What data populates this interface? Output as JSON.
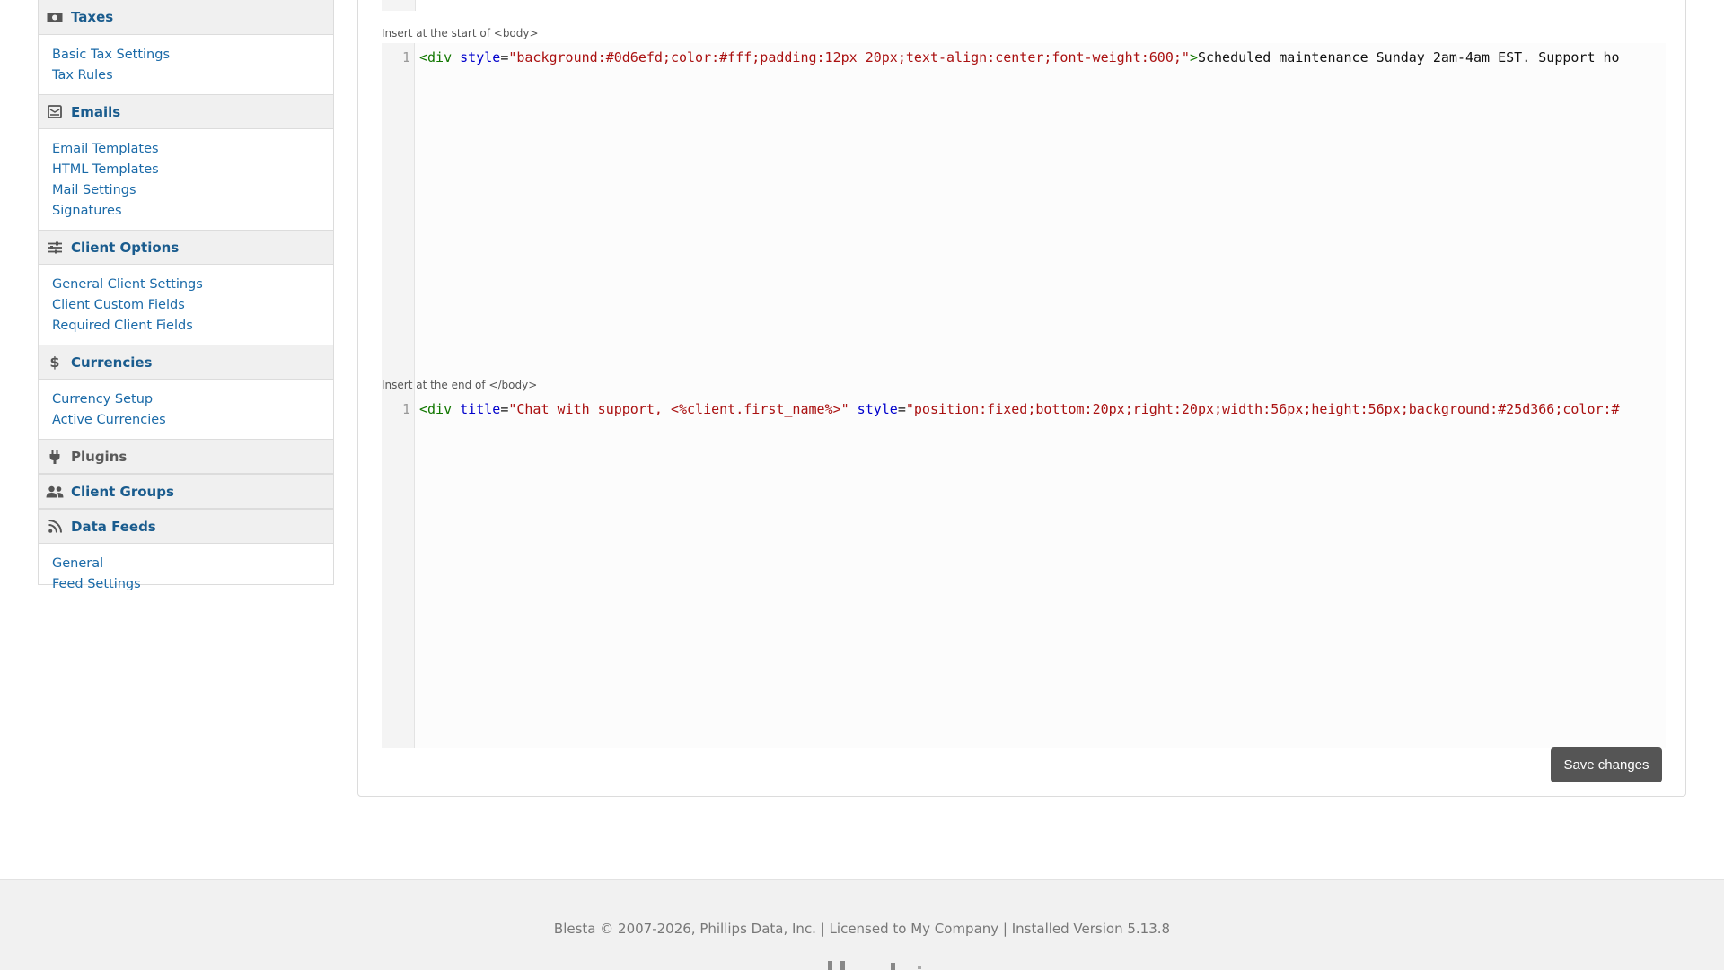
{
  "sidebar": {
    "sections": [
      {
        "title": "Taxes",
        "icon": "money-icon",
        "items": [
          "Basic Tax Settings",
          "Tax Rules"
        ]
      },
      {
        "title": "Emails",
        "icon": "envelope-icon",
        "items": [
          "Email Templates",
          "HTML Templates",
          "Mail Settings",
          "Signatures"
        ]
      },
      {
        "title": "Client Options",
        "icon": "sliders-icon",
        "items": [
          "General Client Settings",
          "Client Custom Fields",
          "Required Client Fields"
        ]
      },
      {
        "title": "Currencies",
        "icon": "dollar-icon",
        "items": [
          "Currency Setup",
          "Active Currencies"
        ]
      },
      {
        "title": "Plugins",
        "icon": "plug-icon",
        "items": []
      },
      {
        "title": "Client Groups",
        "icon": "users-icon",
        "items": []
      },
      {
        "title": "Data Feeds",
        "icon": "rss-icon",
        "items": [
          "General",
          "Feed Settings"
        ]
      }
    ]
  },
  "editors": {
    "head_label": "Insert at the start of <body>",
    "head_line": "1",
    "head_code": {
      "tag_open": "<div",
      "attr1": "style",
      "eq": "=",
      "val1": "\"background:#0d6efd;color:#fff;padding:12px 20px;text-align:center;font-weight:600;\"",
      "close": ">",
      "text": "Scheduled maintenance Sunday 2am-4am EST. Support ho"
    },
    "body_label": "Insert at the end of </body>",
    "body_line": "1",
    "body_code": {
      "tag_open": "<div",
      "attr1": "title",
      "eq": "=",
      "val1": "\"Chat with support, <%client.first_name%>\"",
      "attr2": "style",
      "val2": "\"position:fixed;bottom:20px;right:20px;width:56px;height:56px;background:#25d366;color:#"
    }
  },
  "actions": {
    "save_label": "Save changes"
  },
  "footer": {
    "text": "Blesta © 2007-2026, Phillips Data, Inc. | Licensed to My Company | Installed Version 5.13.8"
  }
}
